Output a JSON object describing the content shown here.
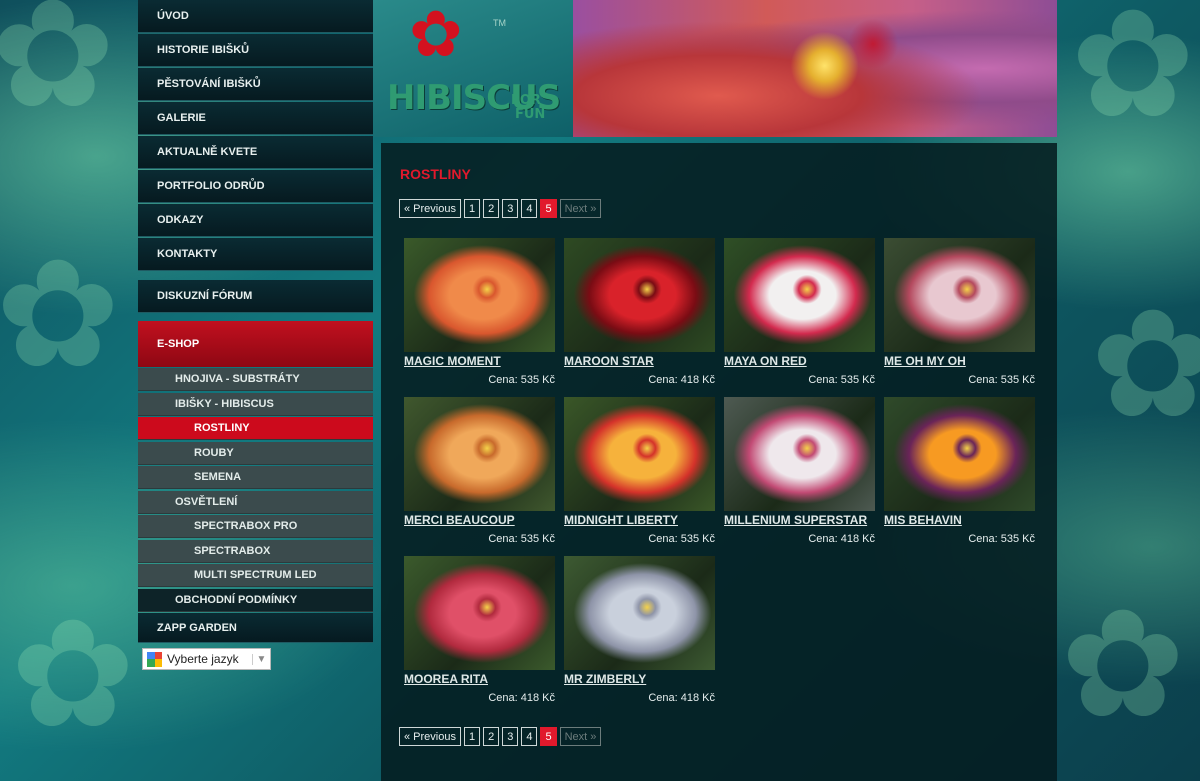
{
  "nav": {
    "main": [
      "ÚVOD",
      "HISTORIE IBIŠKŮ",
      "PĚSTOVÁNÍ IBIŠKŮ",
      "GALERIE",
      "AKTUALNĚ KVETE",
      "PORTFOLIO ODRŮD",
      "ODKAZY",
      "KONTAKTY"
    ],
    "forum": "DISKUZNÍ FÓRUM",
    "eshop": "E-SHOP",
    "sub": [
      {
        "label": "HNOJIVA - SUBSTRÁTY",
        "level": 1,
        "active": false
      },
      {
        "label": "IBIŠKY - HIBISCUS",
        "level": 1,
        "active": false
      },
      {
        "label": "ROSTLINY",
        "level": 2,
        "active": true
      },
      {
        "label": "ROUBY",
        "level": 2,
        "active": false
      },
      {
        "label": "SEMENA",
        "level": 2,
        "active": false
      },
      {
        "label": "OSVĚTLENÍ",
        "level": 1,
        "active": false
      },
      {
        "label": "SPECTRABOX PRO",
        "level": 2,
        "active": false
      },
      {
        "label": "SPECTRABOX",
        "level": 2,
        "active": false
      },
      {
        "label": "MULTI SPECTRUM LED",
        "level": 2,
        "active": false
      },
      {
        "label": "OBCHODNÍ PODMÍNKY",
        "level": 1,
        "active": false
      }
    ],
    "zapp": "ZAPP GARDEN",
    "language": "Vyberte jazyk"
  },
  "logo": {
    "main": "HIBISCUS",
    "small1": "FOR",
    "small2": "FUN",
    "tm": "TM"
  },
  "page": {
    "title": "ROSTLINY",
    "pager": {
      "prev": "« Previous",
      "pages": [
        "1",
        "2",
        "3",
        "4",
        "5"
      ],
      "current": "5",
      "next": "Next »"
    }
  },
  "products": [
    {
      "name": "MAGIC MOMENT",
      "price": "Cena: 535 Kč",
      "colors": [
        "#f08a4a",
        "#d9572e",
        "#3a5a2a"
      ]
    },
    {
      "name": "MAROON STAR",
      "price": "Cena: 418 Kč",
      "colors": [
        "#d9222a",
        "#7a0c14",
        "#2e4a23"
      ]
    },
    {
      "name": "MAYA ON RED",
      "price": "Cena: 535 Kč",
      "colors": [
        "#f2f0f0",
        "#d32a4e",
        "#2f4f26"
      ]
    },
    {
      "name": "ME OH MY OH",
      "price": "Cena: 535 Kč",
      "colors": [
        "#e8c8d0",
        "#b4495e",
        "#3b4d33"
      ]
    },
    {
      "name": "MERCI BEAUCOUP",
      "price": "Cena: 535 Kč",
      "colors": [
        "#f0a85a",
        "#c86a2c",
        "#40582e"
      ]
    },
    {
      "name": "MIDNIGHT LIBERTY",
      "price": "Cena: 535 Kč",
      "colors": [
        "#f6b23c",
        "#d4322a",
        "#3a5728"
      ]
    },
    {
      "name": "MILLENIUM SUPERSTAR",
      "price": "Cena: 418 Kč",
      "colors": [
        "#efe8ec",
        "#c24a74",
        "#4e5a52"
      ]
    },
    {
      "name": "MIS BEHAVIN",
      "price": "Cena: 535 Kč",
      "colors": [
        "#f79a22",
        "#6a2458",
        "#2f4a2a"
      ]
    },
    {
      "name": "MOOREA RITA",
      "price": "Cena: 418 Kč",
      "colors": [
        "#e05068",
        "#b12a3e",
        "#3b5a2c"
      ]
    },
    {
      "name": "MR ZIMBERLY",
      "price": "Cena: 418 Kč",
      "colors": [
        "#c9d0dc",
        "#8e94a8",
        "#3d5a32"
      ]
    }
  ]
}
